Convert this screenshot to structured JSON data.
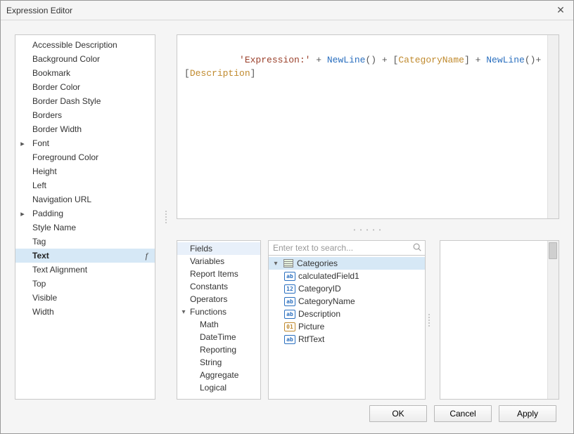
{
  "dialog": {
    "title": "Expression Editor"
  },
  "properties": {
    "items": [
      {
        "label": "Accessible Description",
        "expandable": false
      },
      {
        "label": "Background Color",
        "expandable": false
      },
      {
        "label": "Bookmark",
        "expandable": false
      },
      {
        "label": "Border Color",
        "expandable": false
      },
      {
        "label": "Border Dash Style",
        "expandable": false
      },
      {
        "label": "Borders",
        "expandable": false
      },
      {
        "label": "Border Width",
        "expandable": false
      },
      {
        "label": "Font",
        "expandable": true
      },
      {
        "label": "Foreground Color",
        "expandable": false
      },
      {
        "label": "Height",
        "expandable": false
      },
      {
        "label": "Left",
        "expandable": false
      },
      {
        "label": "Navigation URL",
        "expandable": false
      },
      {
        "label": "Padding",
        "expandable": true
      },
      {
        "label": "Style Name",
        "expandable": false
      },
      {
        "label": "Tag",
        "expandable": false
      },
      {
        "label": "Text",
        "expandable": false,
        "selected": true,
        "fx": true
      },
      {
        "label": "Text Alignment",
        "expandable": false
      },
      {
        "label": "Top",
        "expandable": false
      },
      {
        "label": "Visible",
        "expandable": false
      },
      {
        "label": "Width",
        "expandable": false
      }
    ]
  },
  "expression": {
    "tokens": [
      {
        "t": "str",
        "v": "'Expression:'"
      },
      {
        "t": "sp",
        "v": " "
      },
      {
        "t": "op",
        "v": "+"
      },
      {
        "t": "sp",
        "v": " "
      },
      {
        "t": "fn",
        "v": "NewLine"
      },
      {
        "t": "br",
        "v": "()"
      },
      {
        "t": "sp",
        "v": " "
      },
      {
        "t": "op",
        "v": "+"
      },
      {
        "t": "sp",
        "v": " "
      },
      {
        "t": "br",
        "v": "["
      },
      {
        "t": "fld",
        "v": "CategoryName"
      },
      {
        "t": "br",
        "v": "]"
      },
      {
        "t": "sp",
        "v": " "
      },
      {
        "t": "op",
        "v": "+"
      },
      {
        "t": "sp",
        "v": " "
      },
      {
        "t": "fn",
        "v": "NewLine"
      },
      {
        "t": "br",
        "v": "()"
      },
      {
        "t": "op",
        "v": "+"
      },
      {
        "t": "sp",
        "v": " "
      },
      {
        "t": "br",
        "v": "["
      },
      {
        "t": "fld",
        "v": "Description"
      },
      {
        "t": "br",
        "v": "]"
      }
    ]
  },
  "categories": {
    "items": [
      {
        "label": "Fields",
        "selected": true
      },
      {
        "label": "Variables"
      },
      {
        "label": "Report Items"
      },
      {
        "label": "Constants"
      },
      {
        "label": "Operators"
      },
      {
        "label": "Functions",
        "expandable": true,
        "expanded": true
      },
      {
        "label": "Math",
        "sub": true
      },
      {
        "label": "DateTime",
        "sub": true
      },
      {
        "label": "Reporting",
        "sub": true
      },
      {
        "label": "String",
        "sub": true
      },
      {
        "label": "Aggregate",
        "sub": true
      },
      {
        "label": "Logical",
        "sub": true
      }
    ]
  },
  "search": {
    "placeholder": "Enter text to search..."
  },
  "fieldsTree": {
    "root": {
      "label": "Categories",
      "icon": "table",
      "expanded": true,
      "selected": true
    },
    "children": [
      {
        "label": "calculatedField1",
        "icon": "ab"
      },
      {
        "label": "CategoryID",
        "icon": "12"
      },
      {
        "label": "CategoryName",
        "icon": "ab"
      },
      {
        "label": "Description",
        "icon": "ab"
      },
      {
        "label": "Picture",
        "icon": "01"
      },
      {
        "label": "RtfText",
        "icon": "ab"
      }
    ]
  },
  "buttons": {
    "ok": "OK",
    "cancel": "Cancel",
    "apply": "Apply"
  }
}
